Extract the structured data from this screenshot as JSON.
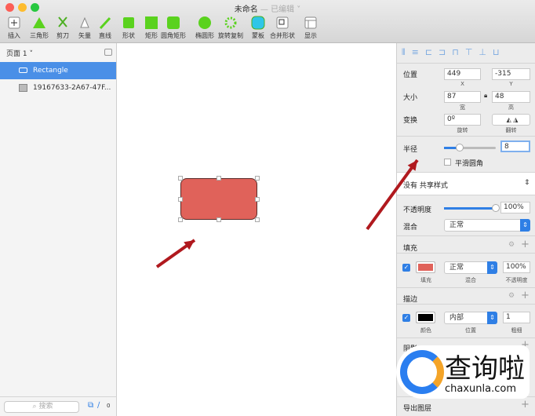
{
  "window": {
    "title": "未命名",
    "status": "— 已编辑 ˅"
  },
  "toolbar": [
    {
      "label": "插入",
      "icon": "plus-icon"
    },
    {
      "label": "三角形",
      "icon": "triangle-icon"
    },
    {
      "label": "剪刀",
      "icon": "scissors-icon"
    },
    {
      "label": "矢量",
      "icon": "pen-icon"
    },
    {
      "label": "直线",
      "icon": "line-icon"
    },
    {
      "label": "形状",
      "icon": "shapes-icon"
    },
    {
      "label": "矩形",
      "icon": "rectangle-icon"
    },
    {
      "label": "圆角矩形",
      "icon": "rounded-rect-icon"
    },
    {
      "label": "椭圆形",
      "icon": "oval-icon"
    },
    {
      "label": "旋转复制",
      "icon": "rotate-copy-icon"
    },
    {
      "label": "蒙板",
      "icon": "mask-icon"
    },
    {
      "label": "合并形状",
      "icon": "combine-icon"
    },
    {
      "label": "显示",
      "icon": "view-icon"
    }
  ],
  "sidebar": {
    "page": "页面 1 ˅",
    "layers": [
      {
        "name": "Rectangle",
        "selected": true
      },
      {
        "name": "19167633-2A67-47F..."
      }
    ],
    "search_placeholder": "搜索",
    "badge": "0"
  },
  "inspector": {
    "position": {
      "label": "位置",
      "x": "449",
      "y": "-315",
      "x_cap": "X",
      "y_cap": "Y"
    },
    "size": {
      "label": "大小",
      "w": "87",
      "h": "48",
      "w_cap": "宽",
      "h_cap": "高"
    },
    "transform": {
      "label": "变换",
      "rotate": "0º",
      "rotate_cap": "旋转",
      "flip_cap": "翻转"
    },
    "radius": {
      "label": "半径",
      "value": "8",
      "slider": 0.3,
      "smooth": "平滑圆角"
    },
    "shared_style": "没有 共享样式",
    "opacity": {
      "label": "不透明度",
      "value": "100%",
      "slider": 1.0
    },
    "blend": {
      "label": "混合",
      "value": "正常"
    },
    "fill": {
      "header": "填充",
      "color": "#e0625a",
      "blend": "正常",
      "opacity": "100%",
      "caps": [
        "填充",
        "混合",
        "不透明度"
      ]
    },
    "border": {
      "header": "描边",
      "color": "#000000",
      "position": "内部",
      "width": "1",
      "caps": [
        "颜色",
        "位置",
        "粗细"
      ]
    },
    "shadow": {
      "header": "阴影"
    },
    "export": "导出图层"
  },
  "shape": {
    "fill": "#e0625a",
    "stroke": "#5a2a28"
  },
  "annotation_color": "#b0191e",
  "watermark": {
    "text": "查询啦",
    "url": "chaxunla.com"
  }
}
